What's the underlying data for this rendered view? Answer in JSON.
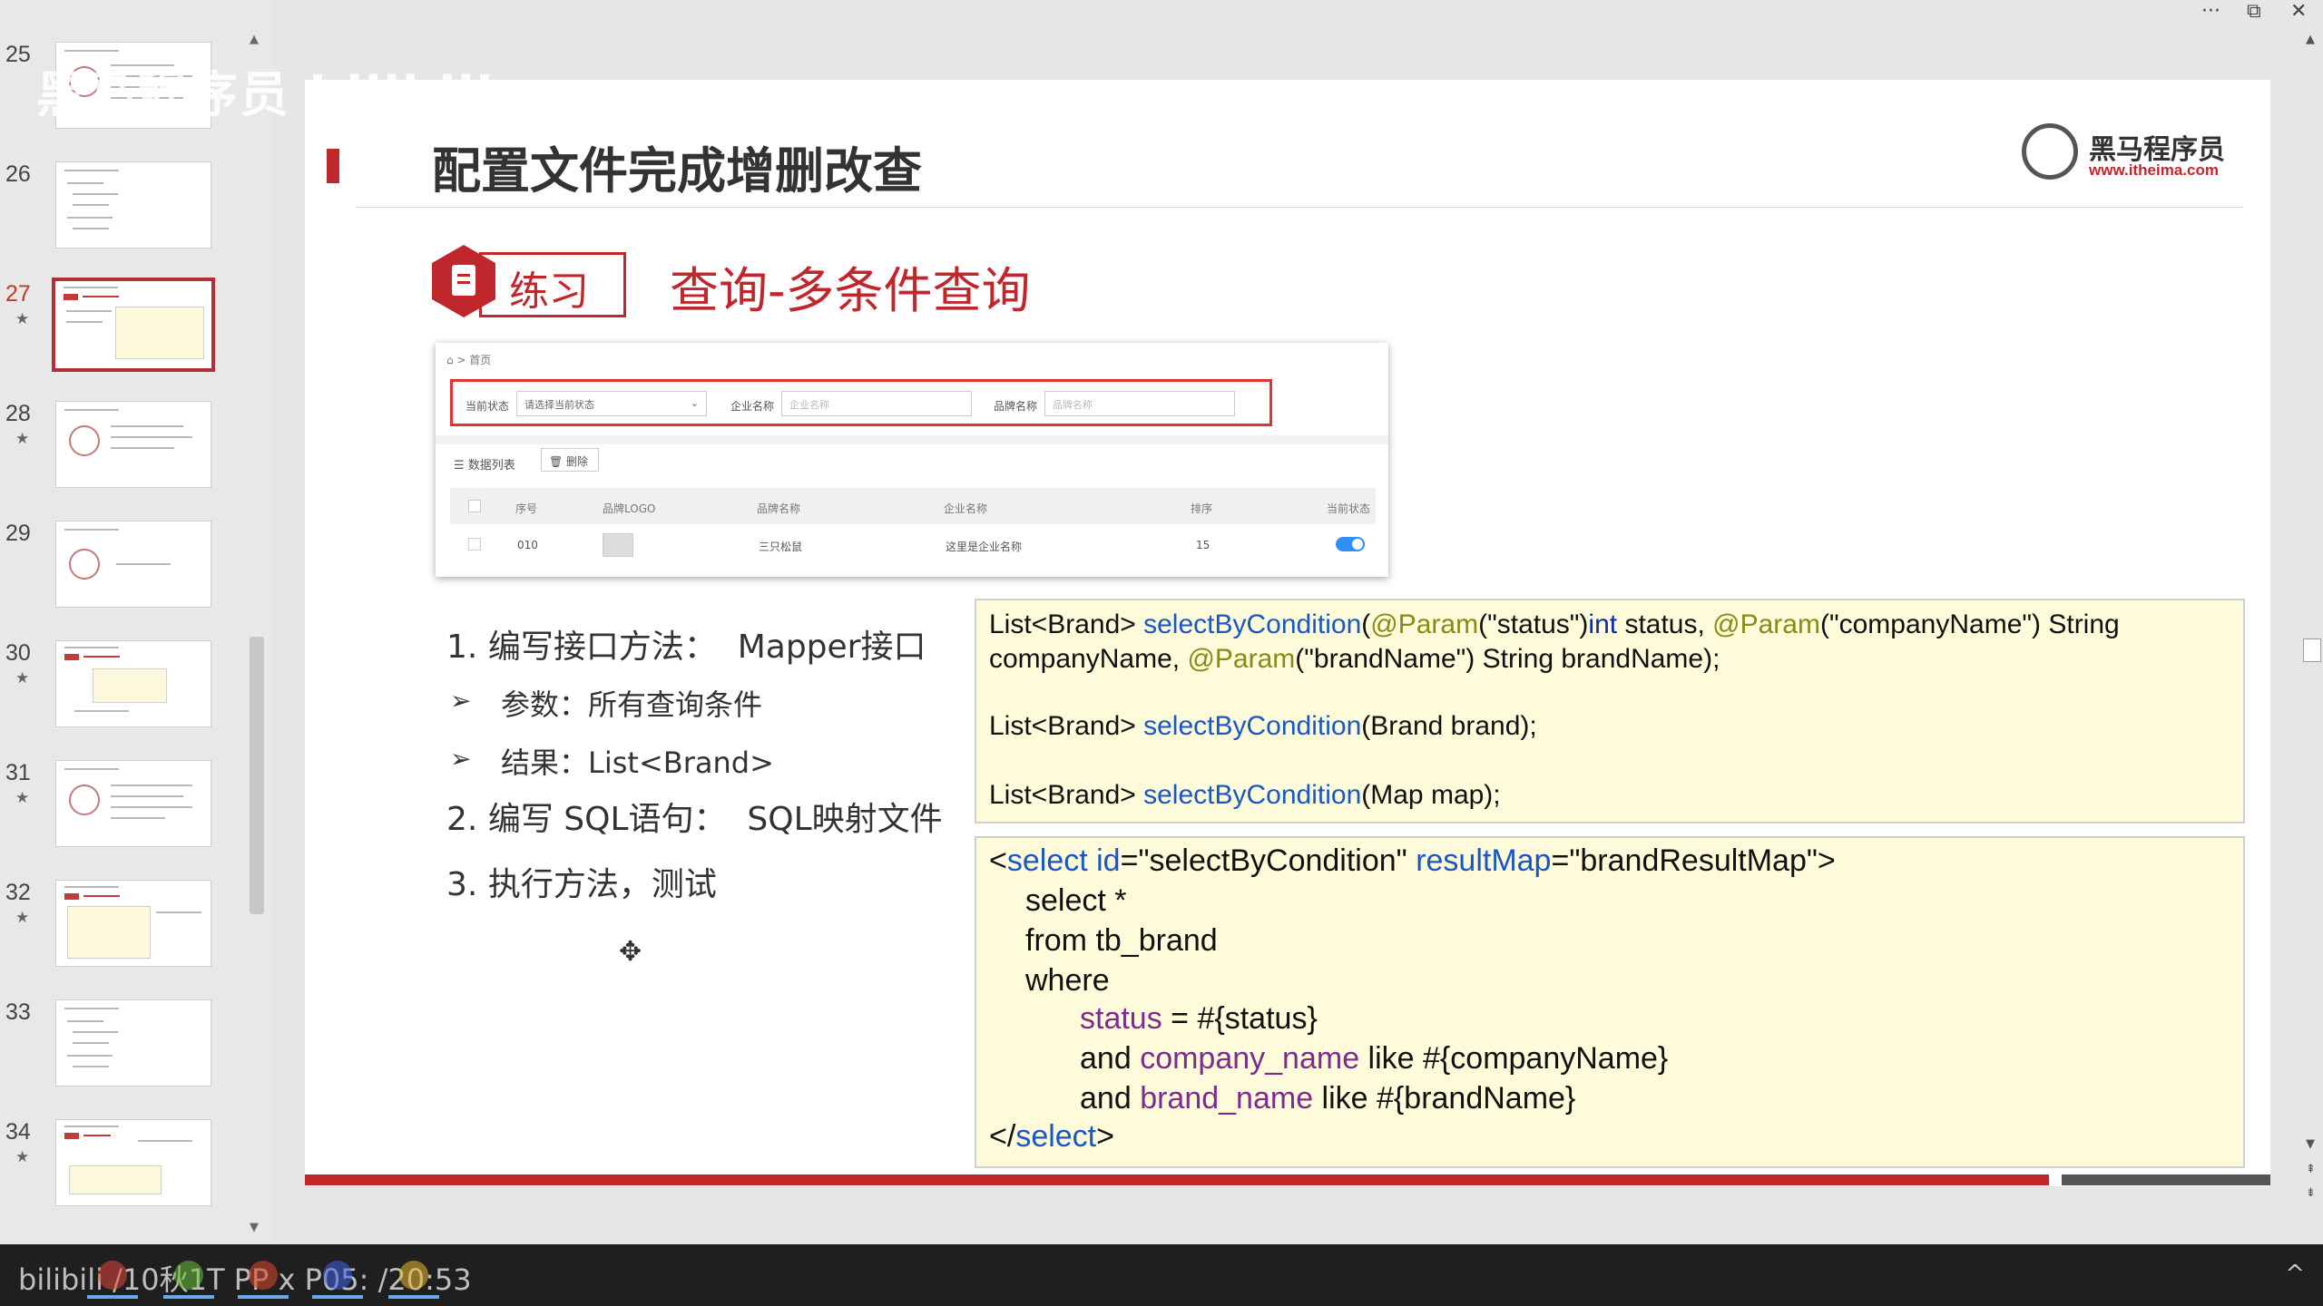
{
  "watermark": "黑马程序员 bilibili",
  "window_controls": {
    "more": "···",
    "restore": "⧉",
    "close": "✕"
  },
  "slides_panel": {
    "items": [
      {
        "num": "25",
        "star": ""
      },
      {
        "num": "26",
        "star": ""
      },
      {
        "num": "27",
        "star": "★",
        "active": true
      },
      {
        "num": "28",
        "star": "★"
      },
      {
        "num": "29",
        "star": ""
      },
      {
        "num": "30",
        "star": "★"
      },
      {
        "num": "31",
        "star": "★"
      },
      {
        "num": "32",
        "star": "★"
      },
      {
        "num": "33",
        "star": ""
      },
      {
        "num": "34",
        "star": "★"
      }
    ],
    "scroll_up": "▲",
    "scroll_down": "▼"
  },
  "slide": {
    "title": "配置文件完成增删改查",
    "logo": {
      "name": "黑马程序员",
      "url": "www.itheima.com"
    },
    "exercise": {
      "label": "练习",
      "title": "查询-多条件查询"
    },
    "screenshot": {
      "breadcrumb": "⌂ > 首页",
      "filters": [
        {
          "label": "当前状态",
          "placeholder": "请选择当前状态"
        },
        {
          "label": "企业名称",
          "placeholder": "企业名称"
        },
        {
          "label": "品牌名称",
          "placeholder": "品牌名称"
        }
      ],
      "list_label": "☰ 数据列表",
      "delete_label": "🗑 删除",
      "headers": [
        "序号",
        "品牌LOGO",
        "品牌名称",
        "企业名称",
        "排序",
        "当前状态"
      ],
      "row": {
        "id": "010",
        "brand": "三只松鼠",
        "company": "这里是企业名称",
        "order": "15"
      }
    },
    "steps": [
      {
        "num": "1.",
        "text": "编写接口方法：  Mapper接口"
      },
      {
        "bullet": "➢",
        "text": "参数：所有查询条件"
      },
      {
        "bullet": "➢",
        "text": "结果：List<Brand>"
      },
      {
        "num": "2.",
        "text": "编写 SQL语句：  SQL映射文件"
      },
      {
        "num": "3.",
        "text": "执行方法，测试"
      }
    ],
    "code_interface": {
      "l1": {
        "a": "List<Brand> ",
        "b": "selectByCondition",
        "c": "(",
        "d": "@Param",
        "e": "(\"status\")",
        "f": "int",
        "g": " status, ",
        "h": "@Param",
        "i": "(\"companyName\") String"
      },
      "l2": {
        "a": "companyName, ",
        "b": "@Param",
        "c": "(\"brandName\") String brandName);"
      },
      "l3": {
        "a": "List<Brand> ",
        "b": "selectByCondition",
        "c": "(Brand brand);"
      },
      "l4": {
        "a": "List<Brand> ",
        "b": "selectByCondition",
        "c": "(Map map);"
      }
    },
    "code_xml": {
      "l1": {
        "a": "<",
        "b": "select id",
        "c": "=\"selectByCondition\" ",
        "d": "resultMap",
        "e": "=\"brandResultMap\">"
      },
      "l2": "select *",
      "l3": "from tb_brand",
      "l4": "where",
      "l5": {
        "a": "status",
        "b": " = #{status}"
      },
      "l6": {
        "a": "and ",
        "b": "company_name",
        "c": " like #{companyName}"
      },
      "l7": {
        "a": "and ",
        "b": "brand_name",
        "c": " like #{brandName}"
      },
      "l8": {
        "a": "</",
        "b": "select",
        "c": ">"
      }
    }
  },
  "taskbar": {
    "left_text": "bilibili  /10秋1T  PP x  P05:  /20:53",
    "chevron": "^"
  },
  "colors": {
    "accent": "#c0272d",
    "code_bg": "#fdfbd9",
    "keyword_blue": "#1a56c4",
    "param_olive": "#8a8a16",
    "field_purple": "#7c2c8e"
  }
}
